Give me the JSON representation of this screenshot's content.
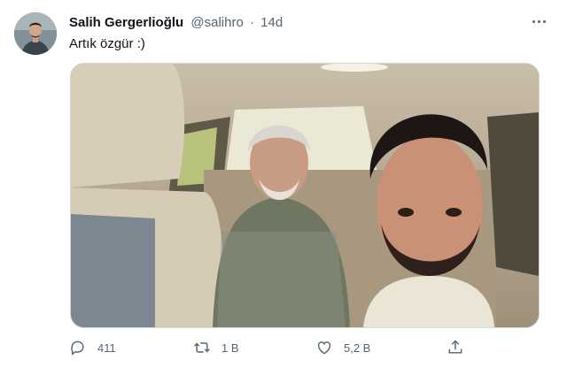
{
  "tweet": {
    "author_name": "Salih Gergerlioğlu",
    "handle": "@salihro",
    "separator": "·",
    "time": "14d",
    "text": "Artık özgür :)",
    "avatar_icon": "user-avatar-photo",
    "more_icon": "more-options-icon",
    "media": {
      "description_icon": "car-selfie-photo"
    },
    "actions": {
      "reply_count": "411",
      "retweet_count": "1 B",
      "like_count": "5,2 B"
    }
  },
  "colors": {
    "text_primary": "#0f1419",
    "text_secondary": "#536471",
    "border": "#cfd9de"
  }
}
